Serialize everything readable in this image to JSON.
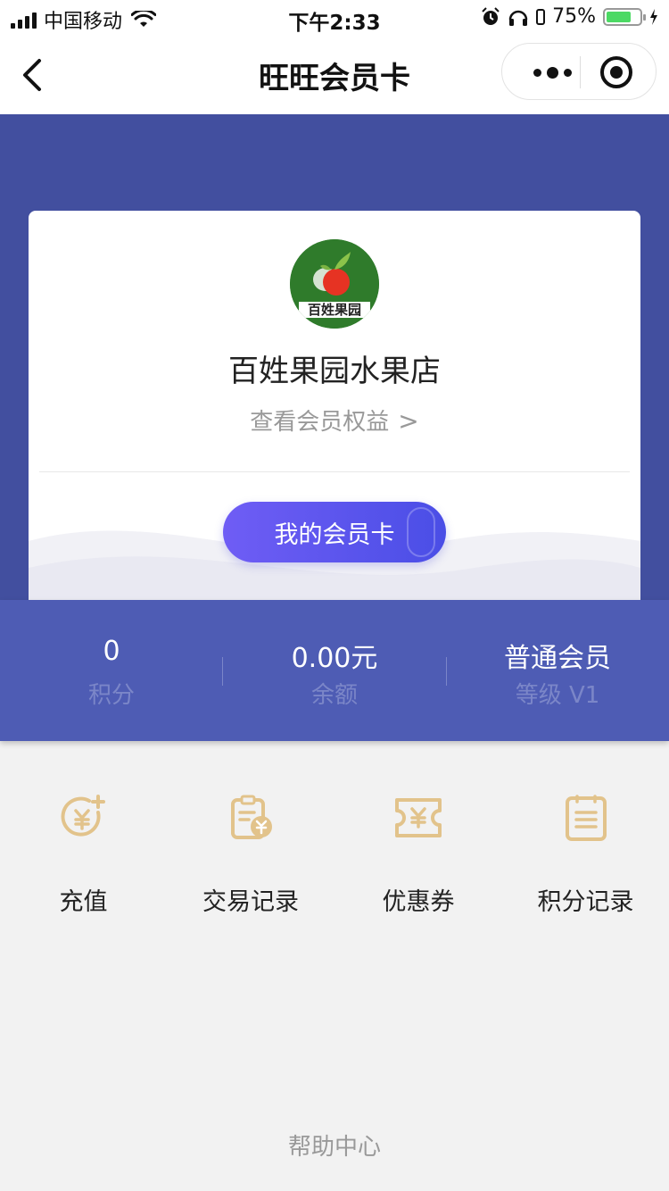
{
  "status_bar": {
    "carrier": "中国移动",
    "time": "下午2:33",
    "battery_percent": "75%",
    "battery_level": 0.75
  },
  "nav": {
    "title": "旺旺会员卡"
  },
  "card": {
    "logo_text": "百姓果园",
    "shop_name": "百姓果园水果店",
    "benefits_link": "查看会员权益",
    "benefits_chevron": ">",
    "button_label": "我的会员卡"
  },
  "stats": [
    {
      "value": "0",
      "label": "积分"
    },
    {
      "value": "0.00元",
      "label": "余额"
    },
    {
      "value": "普通会员",
      "label": "等级 V1"
    }
  ],
  "menu": [
    {
      "label": "充值",
      "icon": "recharge-icon"
    },
    {
      "label": "交易记录",
      "icon": "transaction-record-icon"
    },
    {
      "label": "优惠券",
      "icon": "coupon-icon"
    },
    {
      "label": "积分记录",
      "icon": "points-record-icon"
    }
  ],
  "footer": {
    "help": "帮助中心"
  },
  "colors": {
    "header_bg": "#424f9f",
    "stats_bg": "#4e5cb4",
    "icon_gold": "#e2c38b",
    "button_gradient_start": "#6f5df5",
    "button_gradient_end": "#4a4ee6"
  }
}
